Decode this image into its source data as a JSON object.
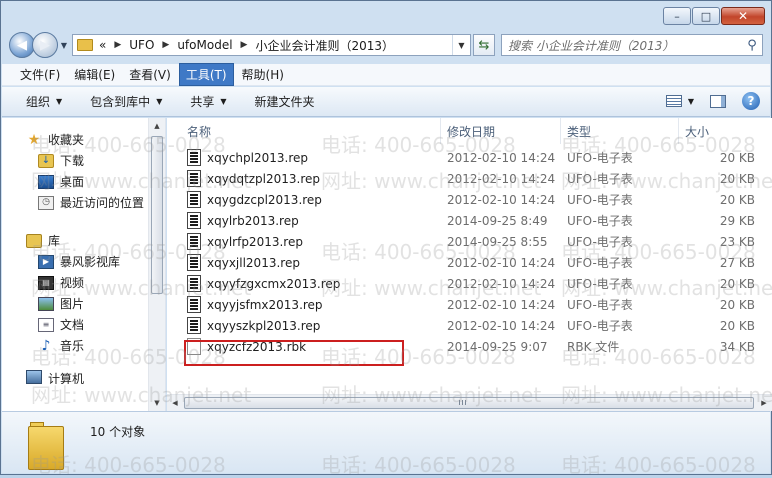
{
  "window": {
    "caption_minimize": "–",
    "caption_maximize": "□",
    "caption_close": "✕"
  },
  "address": {
    "overflow": "«",
    "breadcrumb": [
      "UFO",
      "ufoModel",
      "小企业会计准则（2013）"
    ],
    "search_placeholder": "搜索 小企业会计准则（2013）"
  },
  "menu": {
    "items": [
      "文件(F)",
      "编辑(E)",
      "查看(V)",
      "工具(T)",
      "帮助(H)"
    ],
    "active": "工具(T)"
  },
  "toolbar": {
    "organize": "组织",
    "include_in_library": "包含到库中",
    "share": "共享",
    "new_folder": "新建文件夹"
  },
  "navpane": {
    "favorites": "收藏夹",
    "downloads": "下载",
    "desktop": "桌面",
    "recent": "最近访问的位置",
    "libraries": "库",
    "storm_video": "暴风影视库",
    "videos": "视频",
    "pictures": "图片",
    "documents": "文档",
    "music": "音乐",
    "computer": "计算机"
  },
  "columns": {
    "name": "名称",
    "date": "修改日期",
    "type": "类型",
    "size": "大小"
  },
  "files": [
    {
      "name": "xqychpl2013.rep",
      "date": "2012-02-10 14:24",
      "type": "UFO-电子表",
      "size": "20 KB",
      "kind": "rep"
    },
    {
      "name": "xqydqtzpl2013.rep",
      "date": "2012-02-10 14:24",
      "type": "UFO-电子表",
      "size": "20 KB",
      "kind": "rep"
    },
    {
      "name": "xqygdzcpl2013.rep",
      "date": "2012-02-10 14:24",
      "type": "UFO-电子表",
      "size": "20 KB",
      "kind": "rep"
    },
    {
      "name": "xqylrb2013.rep",
      "date": "2014-09-25 8:49",
      "type": "UFO-电子表",
      "size": "29 KB",
      "kind": "rep"
    },
    {
      "name": "xqylrfp2013.rep",
      "date": "2014-09-25 8:55",
      "type": "UFO-电子表",
      "size": "23 KB",
      "kind": "rep"
    },
    {
      "name": "xqyxjll2013.rep",
      "date": "2012-02-10 14:24",
      "type": "UFO-电子表",
      "size": "27 KB",
      "kind": "rep"
    },
    {
      "name": "xqyyfzgxcmx2013.rep",
      "date": "2012-02-10 14:24",
      "type": "UFO-电子表",
      "size": "20 KB",
      "kind": "rep"
    },
    {
      "name": "xqyyjsfmx2013.rep",
      "date": "2012-02-10 14:24",
      "type": "UFO-电子表",
      "size": "20 KB",
      "kind": "rep"
    },
    {
      "name": "xqyyszkpl2013.rep",
      "date": "2012-02-10 14:24",
      "type": "UFO-电子表",
      "size": "20 KB",
      "kind": "rep"
    },
    {
      "name": "xqyzcfz2013.rbk",
      "date": "2014-09-25 9:07",
      "type": "RBK 文件",
      "size": "34 KB",
      "kind": "rbk"
    }
  ],
  "status": {
    "object_count": "10 个对象"
  },
  "watermark": {
    "phone": "电话: 400-665-0028",
    "site": "网址: www.chanjet.net"
  }
}
